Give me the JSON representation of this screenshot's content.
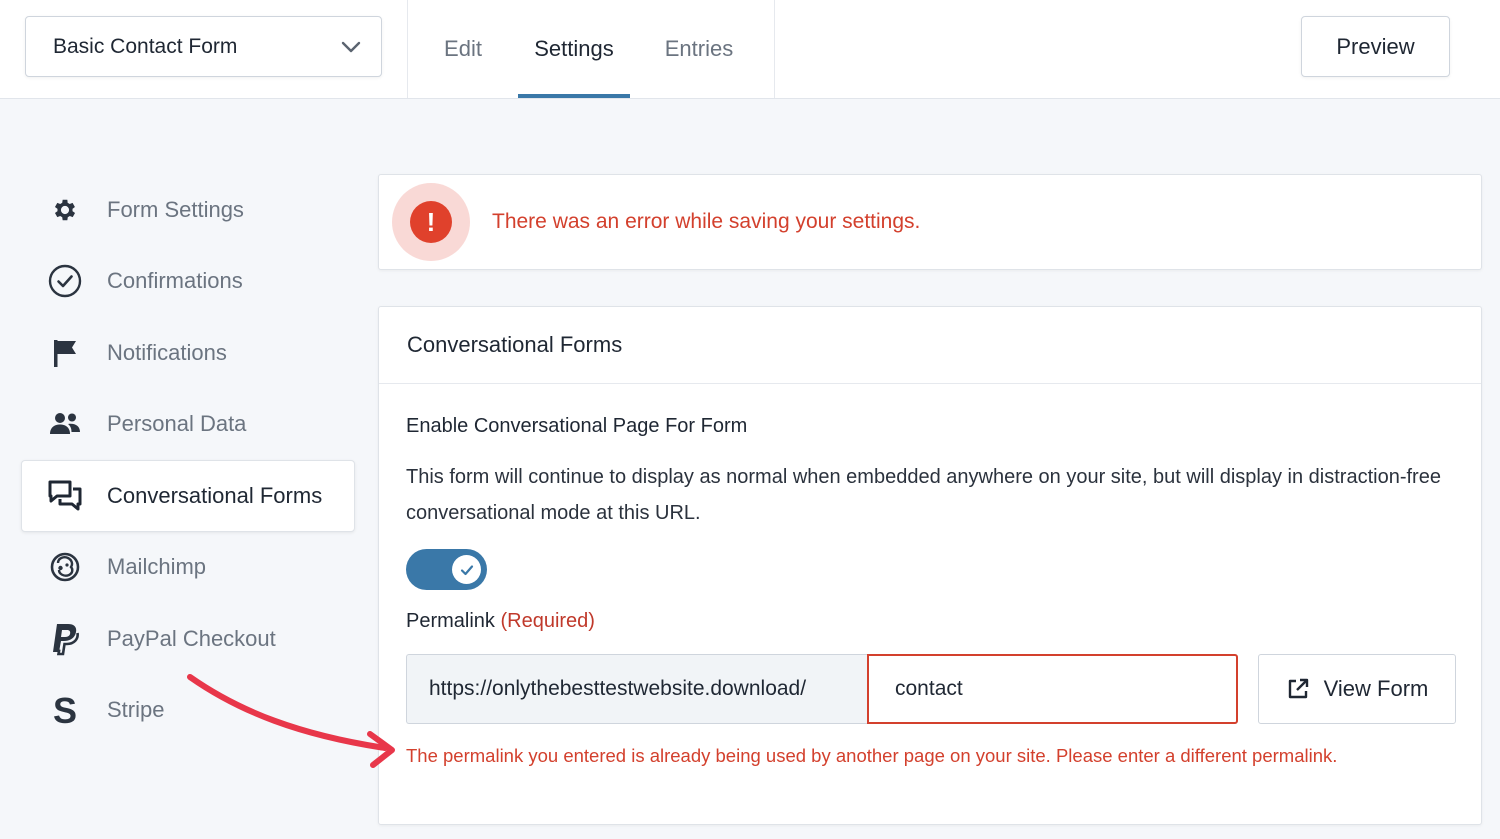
{
  "header": {
    "form_selector": {
      "value": "Basic Contact Form",
      "icon": "chevron-down-icon"
    },
    "tabs": [
      {
        "label": "Edit"
      },
      {
        "label": "Settings",
        "active": true
      },
      {
        "label": "Entries"
      }
    ],
    "preview_label": "Preview"
  },
  "sidebar": {
    "items": [
      {
        "label": "Form Settings",
        "icon": "gear-icon"
      },
      {
        "label": "Confirmations",
        "icon": "check-circle-icon"
      },
      {
        "label": "Notifications",
        "icon": "flag-icon"
      },
      {
        "label": "Personal Data",
        "icon": "users-icon"
      },
      {
        "label": "Conversational Forms",
        "icon": "chat-bubbles-icon",
        "active": true
      },
      {
        "label": "Mailchimp",
        "icon": "mailchimp-icon"
      },
      {
        "label": "PayPal Checkout",
        "icon": "paypal-icon"
      },
      {
        "label": "Stripe",
        "icon": "stripe-icon"
      }
    ]
  },
  "error_banner": {
    "icon_glyph": "!",
    "message": "There was an error while saving your settings."
  },
  "panel": {
    "title": "Conversational Forms",
    "field_label": "Enable Conversational Page For Form",
    "description": "This form will continue to display as normal when embedded anywhere on your site, but will display in distraction-free conversational mode at this URL.",
    "toggle_enabled": true,
    "permalink": {
      "label": "Permalink",
      "required_text": "(Required)",
      "prefix": "https://onlythebesttestwebsite.download/",
      "value": "contact",
      "view_button_label": "View Form",
      "error": "The permalink you entered is already being used by another page on your site. Please enter a different permalink."
    }
  },
  "colors": {
    "accent": "#3a78a8",
    "error": "#d3402d",
    "error_halo": "#f9d9d6",
    "annotation_arrow": "#e8374a"
  }
}
